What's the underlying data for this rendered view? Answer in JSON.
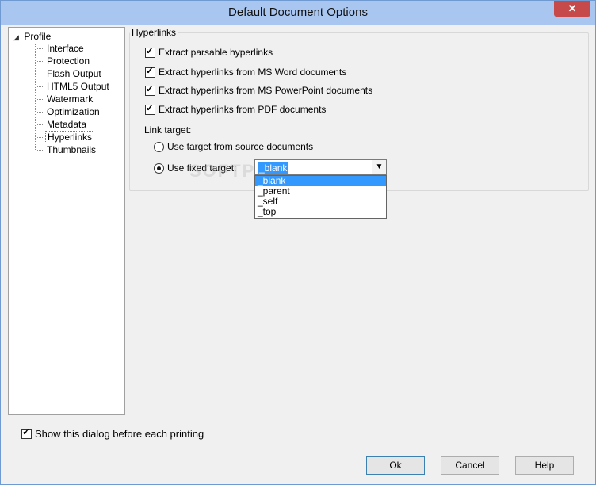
{
  "window": {
    "title": "Default Document Options",
    "close_glyph": "✕"
  },
  "tree": {
    "root": "Profile",
    "items": [
      "Interface",
      "Protection",
      "Flash Output",
      "HTML5 Output",
      "Watermark",
      "Optimization",
      "Metadata",
      "Hyperlinks",
      "Thumbnails"
    ],
    "selected": "Hyperlinks"
  },
  "hyperlinks": {
    "group_title": "Hyperlinks",
    "options": [
      {
        "label": "Extract parsable hyperlinks",
        "checked": true
      },
      {
        "label": "Extract hyperlinks from MS Word documents",
        "checked": true
      },
      {
        "label": "Extract hyperlinks from MS PowerPoint documents",
        "checked": true
      },
      {
        "label": "Extract hyperlinks from PDF documents",
        "checked": true
      }
    ],
    "link_target_label": "Link target:",
    "radio_source": {
      "label": "Use target from source documents",
      "selected": false
    },
    "radio_fixed": {
      "label": "Use fixed target:",
      "selected": true
    },
    "combo": {
      "value": "_blank",
      "options": [
        "_blank",
        "_parent",
        "_self",
        "_top"
      ],
      "highlighted": "_blank"
    }
  },
  "watermark_text": "SOFTPEDIA",
  "footer": {
    "show_dialog_label": "Show this dialog before each printing",
    "show_dialog_checked": true,
    "ok_label": "Ok",
    "cancel_label": "Cancel",
    "help_label": "Help"
  },
  "colors": {
    "titlebar": "#a9c6f0",
    "selection": "#3399ff",
    "close": "#c74a4a"
  }
}
